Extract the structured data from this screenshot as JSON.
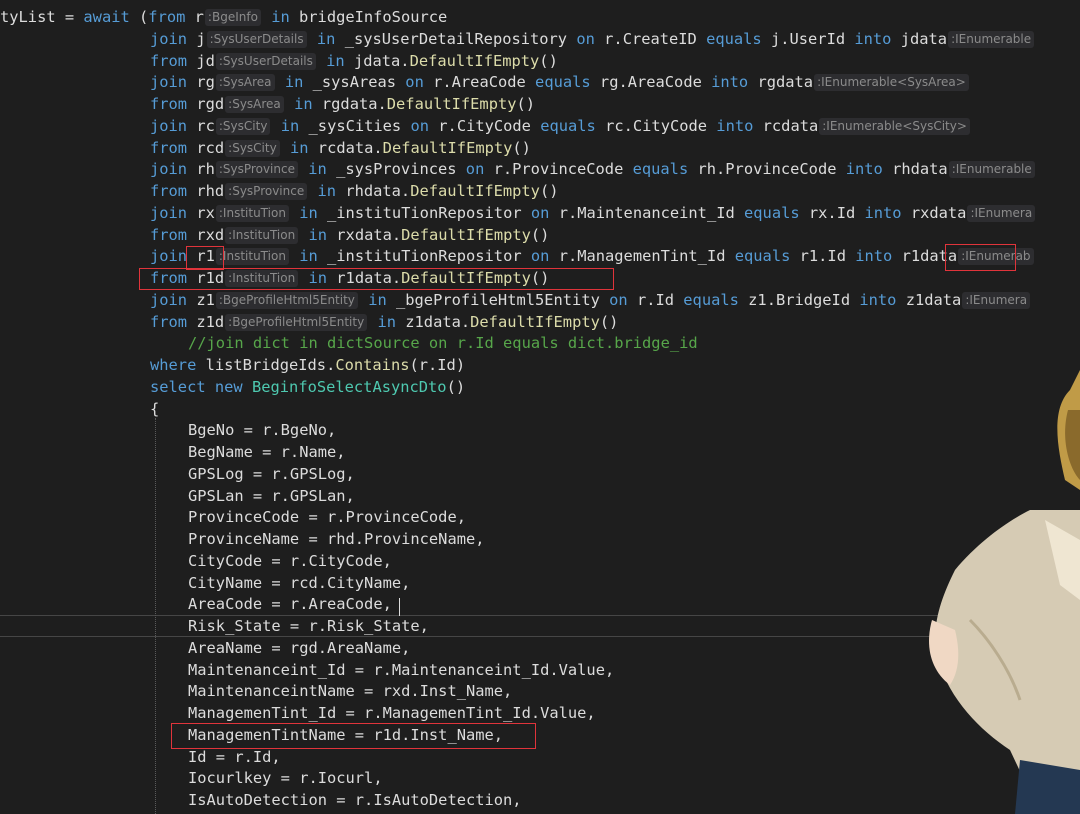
{
  "editor": {
    "language": "csharp",
    "theme": "dark",
    "background_figure": "anime-character",
    "lines": [
      {
        "indent": 0,
        "tokens": [
          {
            "t": "id",
            "v": "tyList = "
          },
          {
            "t": "kw",
            "v": "await"
          },
          {
            "t": "id",
            "v": " ("
          },
          {
            "t": "kw",
            "v": "from"
          },
          {
            "t": "id",
            "v": " r"
          },
          {
            "t": "hint",
            "v": ":BgeInfo"
          },
          {
            "t": "id",
            "v": " "
          },
          {
            "t": "kw",
            "v": "in"
          },
          {
            "t": "id",
            "v": " bridgeInfoSource"
          }
        ]
      },
      {
        "indent": 150,
        "tokens": [
          {
            "t": "kw",
            "v": "join"
          },
          {
            "t": "id",
            "v": " j"
          },
          {
            "t": "hint",
            "v": ":SysUserDetails"
          },
          {
            "t": "id",
            "v": " "
          },
          {
            "t": "kw",
            "v": "in"
          },
          {
            "t": "id",
            "v": " _sysUserDetailRepository "
          },
          {
            "t": "kw",
            "v": "on"
          },
          {
            "t": "id",
            "v": " r.CreateID "
          },
          {
            "t": "kw",
            "v": "equals"
          },
          {
            "t": "id",
            "v": " j.UserId "
          },
          {
            "t": "kw",
            "v": "into"
          },
          {
            "t": "id",
            "v": " jdata"
          },
          {
            "t": "hint",
            "v": ":IEnumerable"
          }
        ]
      },
      {
        "indent": 150,
        "tokens": [
          {
            "t": "kw",
            "v": "from"
          },
          {
            "t": "id",
            "v": " jd"
          },
          {
            "t": "hint",
            "v": ":SysUserDetails"
          },
          {
            "t": "id",
            "v": " "
          },
          {
            "t": "kw",
            "v": "in"
          },
          {
            "t": "id",
            "v": " jdata."
          },
          {
            "t": "method",
            "v": "DefaultIfEmpty"
          },
          {
            "t": "id",
            "v": "()"
          }
        ]
      },
      {
        "indent": 150,
        "tokens": [
          {
            "t": "kw",
            "v": "join"
          },
          {
            "t": "id",
            "v": " rg"
          },
          {
            "t": "hint",
            "v": ":SysArea"
          },
          {
            "t": "id",
            "v": " "
          },
          {
            "t": "kw",
            "v": "in"
          },
          {
            "t": "id",
            "v": " _sysAreas "
          },
          {
            "t": "kw",
            "v": "on"
          },
          {
            "t": "id",
            "v": " r.AreaCode "
          },
          {
            "t": "kw",
            "v": "equals"
          },
          {
            "t": "id",
            "v": " rg.AreaCode "
          },
          {
            "t": "kw",
            "v": "into"
          },
          {
            "t": "id",
            "v": " rgdata"
          },
          {
            "t": "hint",
            "v": ":IEnumerable<SysArea>"
          }
        ]
      },
      {
        "indent": 150,
        "tokens": [
          {
            "t": "kw",
            "v": "from"
          },
          {
            "t": "id",
            "v": " rgd"
          },
          {
            "t": "hint",
            "v": ":SysArea"
          },
          {
            "t": "id",
            "v": " "
          },
          {
            "t": "kw",
            "v": "in"
          },
          {
            "t": "id",
            "v": " rgdata."
          },
          {
            "t": "method",
            "v": "DefaultIfEmpty"
          },
          {
            "t": "id",
            "v": "()"
          }
        ]
      },
      {
        "indent": 150,
        "tokens": [
          {
            "t": "kw",
            "v": "join"
          },
          {
            "t": "id",
            "v": " rc"
          },
          {
            "t": "hint",
            "v": ":SysCity"
          },
          {
            "t": "id",
            "v": " "
          },
          {
            "t": "kw",
            "v": "in"
          },
          {
            "t": "id",
            "v": " _sysCities "
          },
          {
            "t": "kw",
            "v": "on"
          },
          {
            "t": "id",
            "v": " r.CityCode "
          },
          {
            "t": "kw",
            "v": "equals"
          },
          {
            "t": "id",
            "v": " rc.CityCode "
          },
          {
            "t": "kw",
            "v": "into"
          },
          {
            "t": "id",
            "v": " rcdata"
          },
          {
            "t": "hint",
            "v": ":IEnumerable<SysCity>"
          }
        ]
      },
      {
        "indent": 150,
        "tokens": [
          {
            "t": "kw",
            "v": "from"
          },
          {
            "t": "id",
            "v": " rcd"
          },
          {
            "t": "hint",
            "v": ":SysCity"
          },
          {
            "t": "id",
            "v": " "
          },
          {
            "t": "kw",
            "v": "in"
          },
          {
            "t": "id",
            "v": " rcdata."
          },
          {
            "t": "method",
            "v": "DefaultIfEmpty"
          },
          {
            "t": "id",
            "v": "()"
          }
        ]
      },
      {
        "indent": 150,
        "tokens": [
          {
            "t": "kw",
            "v": "join"
          },
          {
            "t": "id",
            "v": " rh"
          },
          {
            "t": "hint",
            "v": ":SysProvince"
          },
          {
            "t": "id",
            "v": " "
          },
          {
            "t": "kw",
            "v": "in"
          },
          {
            "t": "id",
            "v": " _sysProvinces "
          },
          {
            "t": "kw",
            "v": "on"
          },
          {
            "t": "id",
            "v": " r.ProvinceCode "
          },
          {
            "t": "kw",
            "v": "equals"
          },
          {
            "t": "id",
            "v": " rh.ProvinceCode "
          },
          {
            "t": "kw",
            "v": "into"
          },
          {
            "t": "id",
            "v": " rhdata"
          },
          {
            "t": "hint",
            "v": ":IEnumerable"
          }
        ]
      },
      {
        "indent": 150,
        "tokens": [
          {
            "t": "kw",
            "v": "from"
          },
          {
            "t": "id",
            "v": " rhd"
          },
          {
            "t": "hint",
            "v": ":SysProvince"
          },
          {
            "t": "id",
            "v": " "
          },
          {
            "t": "kw",
            "v": "in"
          },
          {
            "t": "id",
            "v": " rhdata."
          },
          {
            "t": "method",
            "v": "DefaultIfEmpty"
          },
          {
            "t": "id",
            "v": "()"
          }
        ]
      },
      {
        "indent": 150,
        "tokens": [
          {
            "t": "kw",
            "v": "join"
          },
          {
            "t": "id",
            "v": " rx"
          },
          {
            "t": "hint",
            "v": ":InstituTion"
          },
          {
            "t": "id",
            "v": " "
          },
          {
            "t": "kw",
            "v": "in"
          },
          {
            "t": "id",
            "v": " _instituTionRepositor "
          },
          {
            "t": "kw",
            "v": "on"
          },
          {
            "t": "id",
            "v": " r.Maintenanceint_Id "
          },
          {
            "t": "kw",
            "v": "equals"
          },
          {
            "t": "id",
            "v": " rx.Id "
          },
          {
            "t": "kw",
            "v": "into"
          },
          {
            "t": "id",
            "v": " rxdata"
          },
          {
            "t": "hint",
            "v": ":IEnumera"
          }
        ]
      },
      {
        "indent": 150,
        "tokens": [
          {
            "t": "kw",
            "v": "from"
          },
          {
            "t": "id",
            "v": " rxd"
          },
          {
            "t": "hint",
            "v": ":InstituTion"
          },
          {
            "t": "id",
            "v": " "
          },
          {
            "t": "kw",
            "v": "in"
          },
          {
            "t": "id",
            "v": " rxdata."
          },
          {
            "t": "method",
            "v": "DefaultIfEmpty"
          },
          {
            "t": "id",
            "v": "()"
          }
        ]
      },
      {
        "indent": 150,
        "tokens": [
          {
            "t": "kw",
            "v": "join"
          },
          {
            "t": "id",
            "v": " r1"
          },
          {
            "t": "hint",
            "v": ":InstituTion"
          },
          {
            "t": "id",
            "v": " "
          },
          {
            "t": "kw",
            "v": "in"
          },
          {
            "t": "id",
            "v": " _instituTionRepositor "
          },
          {
            "t": "kw",
            "v": "on"
          },
          {
            "t": "id",
            "v": " r.ManagemenTint_Id "
          },
          {
            "t": "kw",
            "v": "equals"
          },
          {
            "t": "id",
            "v": " r1.Id "
          },
          {
            "t": "kw",
            "v": "into"
          },
          {
            "t": "id",
            "v": " r1data"
          },
          {
            "t": "hint",
            "v": ":IEnumerab"
          }
        ]
      },
      {
        "indent": 150,
        "tokens": [
          {
            "t": "kw",
            "v": "from"
          },
          {
            "t": "id",
            "v": " r1d"
          },
          {
            "t": "hint",
            "v": ":InstituTion"
          },
          {
            "t": "id",
            "v": " "
          },
          {
            "t": "kw",
            "v": "in"
          },
          {
            "t": "id",
            "v": " r1data."
          },
          {
            "t": "method",
            "v": "DefaultIfEmpty"
          },
          {
            "t": "id",
            "v": "()"
          }
        ]
      },
      {
        "indent": 150,
        "tokens": [
          {
            "t": "kw",
            "v": "join"
          },
          {
            "t": "id",
            "v": " z1"
          },
          {
            "t": "hint",
            "v": ":BgeProfileHtml5Entity"
          },
          {
            "t": "id",
            "v": " "
          },
          {
            "t": "kw",
            "v": "in"
          },
          {
            "t": "id",
            "v": " _bgeProfileHtml5Entity "
          },
          {
            "t": "kw",
            "v": "on"
          },
          {
            "t": "id",
            "v": " r.Id "
          },
          {
            "t": "kw",
            "v": "equals"
          },
          {
            "t": "id",
            "v": " z1.BridgeId "
          },
          {
            "t": "kw",
            "v": "into"
          },
          {
            "t": "id",
            "v": " z1data"
          },
          {
            "t": "hint",
            "v": ":IEnumera"
          }
        ]
      },
      {
        "indent": 150,
        "tokens": [
          {
            "t": "kw",
            "v": "from"
          },
          {
            "t": "id",
            "v": " z1d"
          },
          {
            "t": "hint",
            "v": ":BgeProfileHtml5Entity"
          },
          {
            "t": "id",
            "v": " "
          },
          {
            "t": "kw",
            "v": "in"
          },
          {
            "t": "id",
            "v": " z1data."
          },
          {
            "t": "method",
            "v": "DefaultIfEmpty"
          },
          {
            "t": "id",
            "v": "()"
          }
        ]
      },
      {
        "indent": 188,
        "tokens": [
          {
            "t": "comment",
            "v": "//join dict in dictSource on r.Id equals dict.bridge_id"
          }
        ]
      },
      {
        "indent": 150,
        "tokens": [
          {
            "t": "kw",
            "v": "where"
          },
          {
            "t": "id",
            "v": " listBridgeIds."
          },
          {
            "t": "method",
            "v": "Contains"
          },
          {
            "t": "id",
            "v": "(r.Id)"
          }
        ]
      },
      {
        "indent": 150,
        "tokens": [
          {
            "t": "kw",
            "v": "select"
          },
          {
            "t": "id",
            "v": " "
          },
          {
            "t": "kw",
            "v": "new"
          },
          {
            "t": "id",
            "v": " "
          },
          {
            "t": "type",
            "v": "BeginfoSelectAsyncDto"
          },
          {
            "t": "id",
            "v": "()"
          }
        ]
      },
      {
        "indent": 150,
        "tokens": [
          {
            "t": "id",
            "v": "{"
          }
        ]
      },
      {
        "indent": 188,
        "tokens": [
          {
            "t": "id",
            "v": "BgeNo = r.BgeNo,"
          }
        ]
      },
      {
        "indent": 188,
        "tokens": [
          {
            "t": "id",
            "v": "BegName = r.Name,"
          }
        ]
      },
      {
        "indent": 188,
        "tokens": [
          {
            "t": "id",
            "v": "GPSLog = r.GPSLog,"
          }
        ]
      },
      {
        "indent": 188,
        "tokens": [
          {
            "t": "id",
            "v": "GPSLan = r.GPSLan,"
          }
        ]
      },
      {
        "indent": 188,
        "tokens": [
          {
            "t": "id",
            "v": "ProvinceCode = r.ProvinceCode,"
          }
        ]
      },
      {
        "indent": 188,
        "tokens": [
          {
            "t": "id",
            "v": "ProvinceName = rhd.ProvinceName,"
          }
        ]
      },
      {
        "indent": 188,
        "tokens": [
          {
            "t": "id",
            "v": "CityCode = r.CityCode,"
          }
        ]
      },
      {
        "indent": 188,
        "tokens": [
          {
            "t": "id",
            "v": "CityName = rcd.CityName,"
          }
        ]
      },
      {
        "indent": 188,
        "tokens": [
          {
            "t": "id",
            "v": "AreaCode = r.AreaCode,"
          }
        ]
      },
      {
        "indent": 188,
        "tokens": [
          {
            "t": "id",
            "v": "Risk_State = r.Risk_State,"
          }
        ]
      },
      {
        "indent": 188,
        "tokens": [
          {
            "t": "id",
            "v": "AreaName = rgd.AreaName,"
          }
        ]
      },
      {
        "indent": 188,
        "tokens": [
          {
            "t": "id",
            "v": "Maintenanceint_Id = r.Maintenanceint_Id.Value,"
          }
        ]
      },
      {
        "indent": 188,
        "tokens": [
          {
            "t": "id",
            "v": "MaintenanceintName = rxd.Inst_Name,"
          }
        ]
      },
      {
        "indent": 188,
        "tokens": [
          {
            "t": "id",
            "v": "ManagemenTint_Id = r.ManagemenTint_Id.Value,"
          }
        ]
      },
      {
        "indent": 188,
        "tokens": [
          {
            "t": "id",
            "v": "ManagemenTintName = r1d.Inst_Name,"
          }
        ]
      },
      {
        "indent": 188,
        "tokens": [
          {
            "t": "id",
            "v": "Id = r.Id,"
          }
        ]
      },
      {
        "indent": 188,
        "tokens": [
          {
            "t": "id",
            "v": "Iocurlkey = r.Iocurl,"
          }
        ]
      },
      {
        "indent": 188,
        "tokens": [
          {
            "t": "id",
            "v": "IsAutoDetection = r.IsAutoDetection,"
          }
        ]
      }
    ],
    "highlighted_lines": [
      12,
      33
    ]
  }
}
